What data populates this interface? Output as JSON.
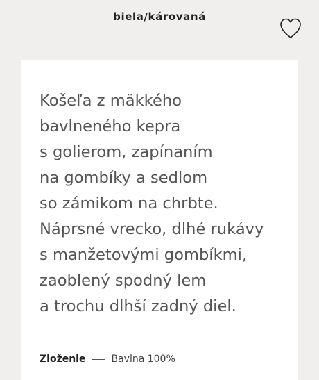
{
  "header": {
    "color_name": "biela/károvaná",
    "favorite_icon": "heart-outline-icon"
  },
  "product": {
    "description_lines": [
      "Košeľa z mäkkého",
      "bavlneného kepra",
      "s golierom, zapínaním",
      "na gombíky a sedlom",
      "so zámikom na chrbte.",
      "Náprsné vrecko, dlhé rukávy",
      "s manžetovými gombíkmi,",
      "zaoblený spodný lem",
      "a trochu dlhší zadný diel."
    ],
    "composition": {
      "label": "Zloženie",
      "value": "Bavlna 100%"
    }
  },
  "colors": {
    "background": "#f0efed",
    "card": "#ffffff",
    "body_text": "#555555",
    "heading_text": "#222222"
  }
}
